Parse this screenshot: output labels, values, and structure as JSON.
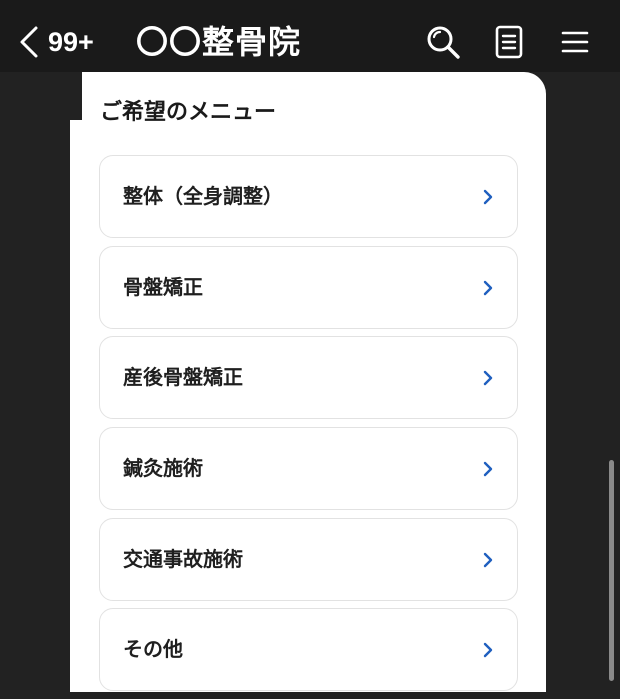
{
  "header": {
    "unread_count": "99+",
    "title": "〇〇整骨院"
  },
  "card": {
    "title": "ご希望のメニュー"
  },
  "menu_items": [
    {
      "label": "整体（全身調整）"
    },
    {
      "label": "骨盤矯正"
    },
    {
      "label": "産後骨盤矯正"
    },
    {
      "label": "鍼灸施術"
    },
    {
      "label": "交通事故施術"
    },
    {
      "label": "その他"
    }
  ],
  "colors": {
    "header_bg": "#1a1a1a",
    "page_bg": "#222222",
    "card_bg": "#ffffff",
    "chevron": "#1f5fbf",
    "item_border": "#e2e2e2"
  },
  "icons": {
    "back": "chevron-left-icon",
    "search": "search-icon",
    "notes": "notes-icon",
    "menu": "hamburger-menu-icon",
    "item_chevron": "chevron-right-icon"
  }
}
